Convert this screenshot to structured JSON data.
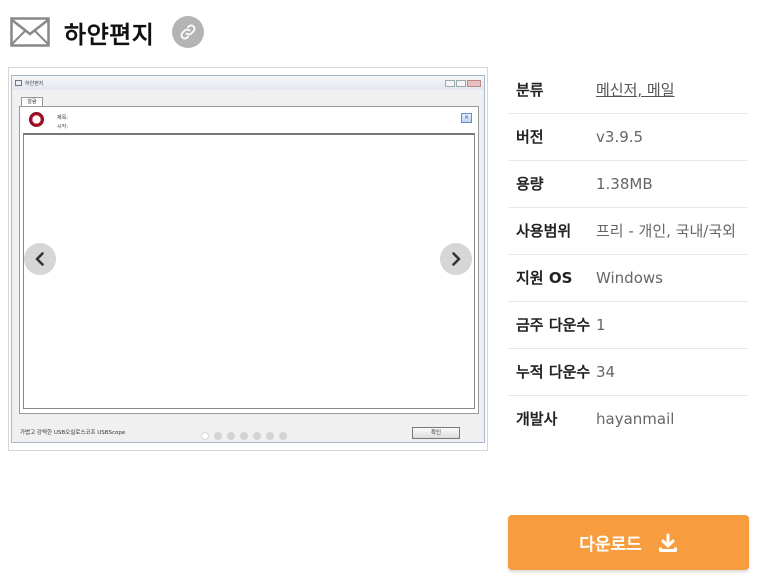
{
  "header": {
    "app_title": "하얀편지",
    "mail_icon": "mail-icon",
    "link_icon": "link-icon"
  },
  "screenshot": {
    "window_title": "하얀편지",
    "tab_label": "알람",
    "field_subject": "제목:",
    "field_time": "시각:",
    "status_text": "가볍고 강력한 USB오실로스코프 USBScope",
    "ok_button": "확인",
    "slide_count": 7,
    "active_slide": 1
  },
  "info": {
    "rows": [
      {
        "label": "분류",
        "value": "메신저, 메일"
      },
      {
        "label": "버전",
        "value": "v3.9.5"
      },
      {
        "label": "용량",
        "value": "1.38MB"
      },
      {
        "label": "사용범위",
        "value": "프리 - 개인, 국내/국외"
      },
      {
        "label": "지원 OS",
        "value": "Windows"
      },
      {
        "label": "금주 다운수",
        "value": "1"
      },
      {
        "label": "누적 다운수",
        "value": "34"
      },
      {
        "label": "개발사",
        "value": "hayanmail"
      }
    ]
  },
  "download": {
    "label": "다운로드",
    "icon": "download-icon",
    "color": "#f89d3f"
  }
}
